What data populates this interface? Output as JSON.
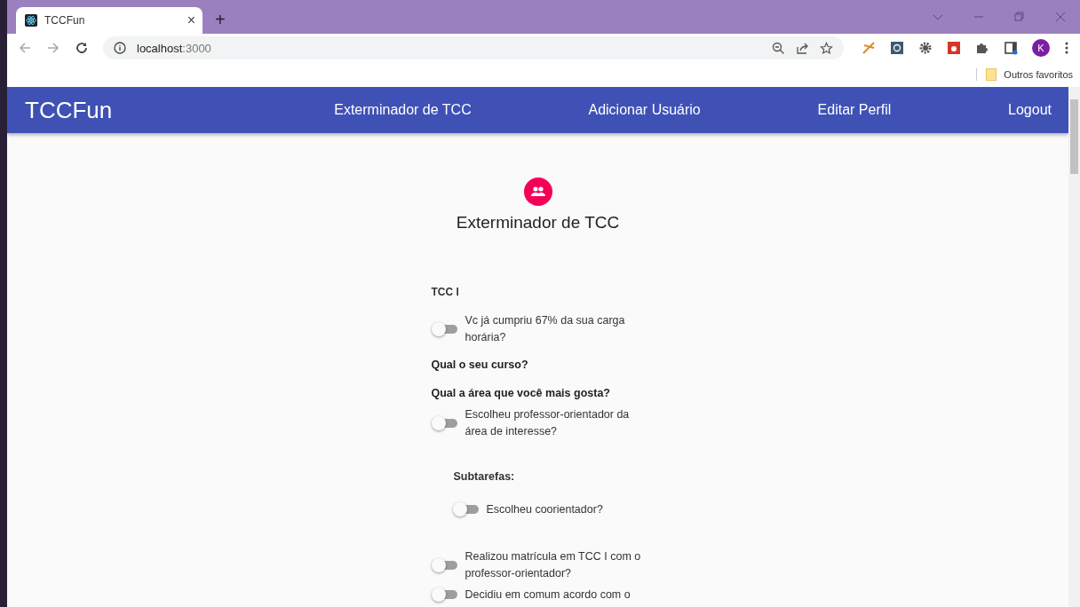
{
  "browser": {
    "tab": {
      "title": "TCCFun",
      "close": "×"
    },
    "new_tab": "+",
    "address": {
      "host": "localhost",
      "port": ":3000"
    },
    "profile_initial": "K",
    "bookmark": "Outros favoritos"
  },
  "app_bar": {
    "brand": "TCCFun",
    "links": [
      "Exterminador de TCC",
      "Adicionar Usuário",
      "Editar Perfil",
      "Logout"
    ]
  },
  "page": {
    "title": "Exterminador de TCC",
    "items": [
      {
        "kind": "section",
        "text": "TCC I"
      },
      {
        "kind": "toggle",
        "text": "Vc já cumpriu 67% da sua carga horária?",
        "on": false
      },
      {
        "kind": "question",
        "text": "Qual o seu curso?"
      },
      {
        "kind": "question",
        "text": "Qual a área que você mais gosta?"
      },
      {
        "kind": "toggle",
        "text": "Escolheu professor-orientador da área de interesse?",
        "on": false
      },
      {
        "kind": "group",
        "text": "Subtarefas:",
        "children": [
          {
            "kind": "toggle",
            "text": "Escolheu coorientador?",
            "on": false
          }
        ]
      },
      {
        "kind": "toggle",
        "text": "Realizou matrícula em TCC I com o professor-orientador?",
        "on": false
      },
      {
        "kind": "toggle",
        "text": "Decidiu em comum acordo com o",
        "on": false
      }
    ]
  }
}
